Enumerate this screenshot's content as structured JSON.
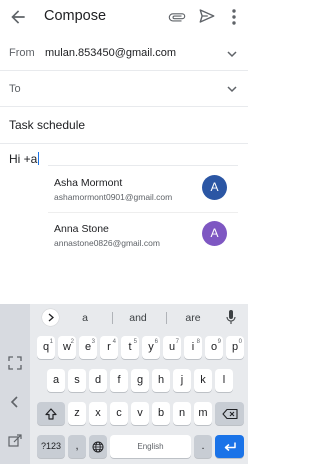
{
  "header": {
    "title": "Compose",
    "back_icon": "arrow-back-icon",
    "attach_icon": "paperclip-icon",
    "send_icon": "send-icon",
    "more_icon": "more-vert-icon"
  },
  "fields": {
    "from_label": "From",
    "from_value": "mulan.853450@gmail.com",
    "to_label": "To",
    "subject_value": "Task schedule",
    "body_value": "Hi +a"
  },
  "suggestions": [
    {
      "name": "Asha Mormont",
      "email": "ashamormont0901@gmail.com",
      "initial": "A",
      "color": "#2b56a4"
    },
    {
      "name": "Anna Stone",
      "email": "annastone0826@gmail.com",
      "initial": "A",
      "color": "#7e57c2"
    }
  ],
  "keyboard": {
    "suggestions": [
      "a",
      "and",
      "are"
    ],
    "row1": [
      {
        "k": "q",
        "n": "1"
      },
      {
        "k": "w",
        "n": "2"
      },
      {
        "k": "e",
        "n": "3"
      },
      {
        "k": "r",
        "n": "4"
      },
      {
        "k": "t",
        "n": "5"
      },
      {
        "k": "y",
        "n": "6"
      },
      {
        "k": "u",
        "n": "7"
      },
      {
        "k": "i",
        "n": "8"
      },
      {
        "k": "o",
        "n": "9"
      },
      {
        "k": "p",
        "n": "0"
      }
    ],
    "row2": [
      "a",
      "s",
      "d",
      "f",
      "g",
      "h",
      "j",
      "k",
      "l"
    ],
    "row3": [
      "z",
      "x",
      "c",
      "v",
      "b",
      "n",
      "m"
    ],
    "symbols_key": "?123",
    "comma_key": ",",
    "space_key": "English",
    "period_key": "."
  },
  "colors": {
    "accent": "#1a73e8",
    "avatar1": "#2b56a4",
    "avatar2": "#7e57c2"
  }
}
